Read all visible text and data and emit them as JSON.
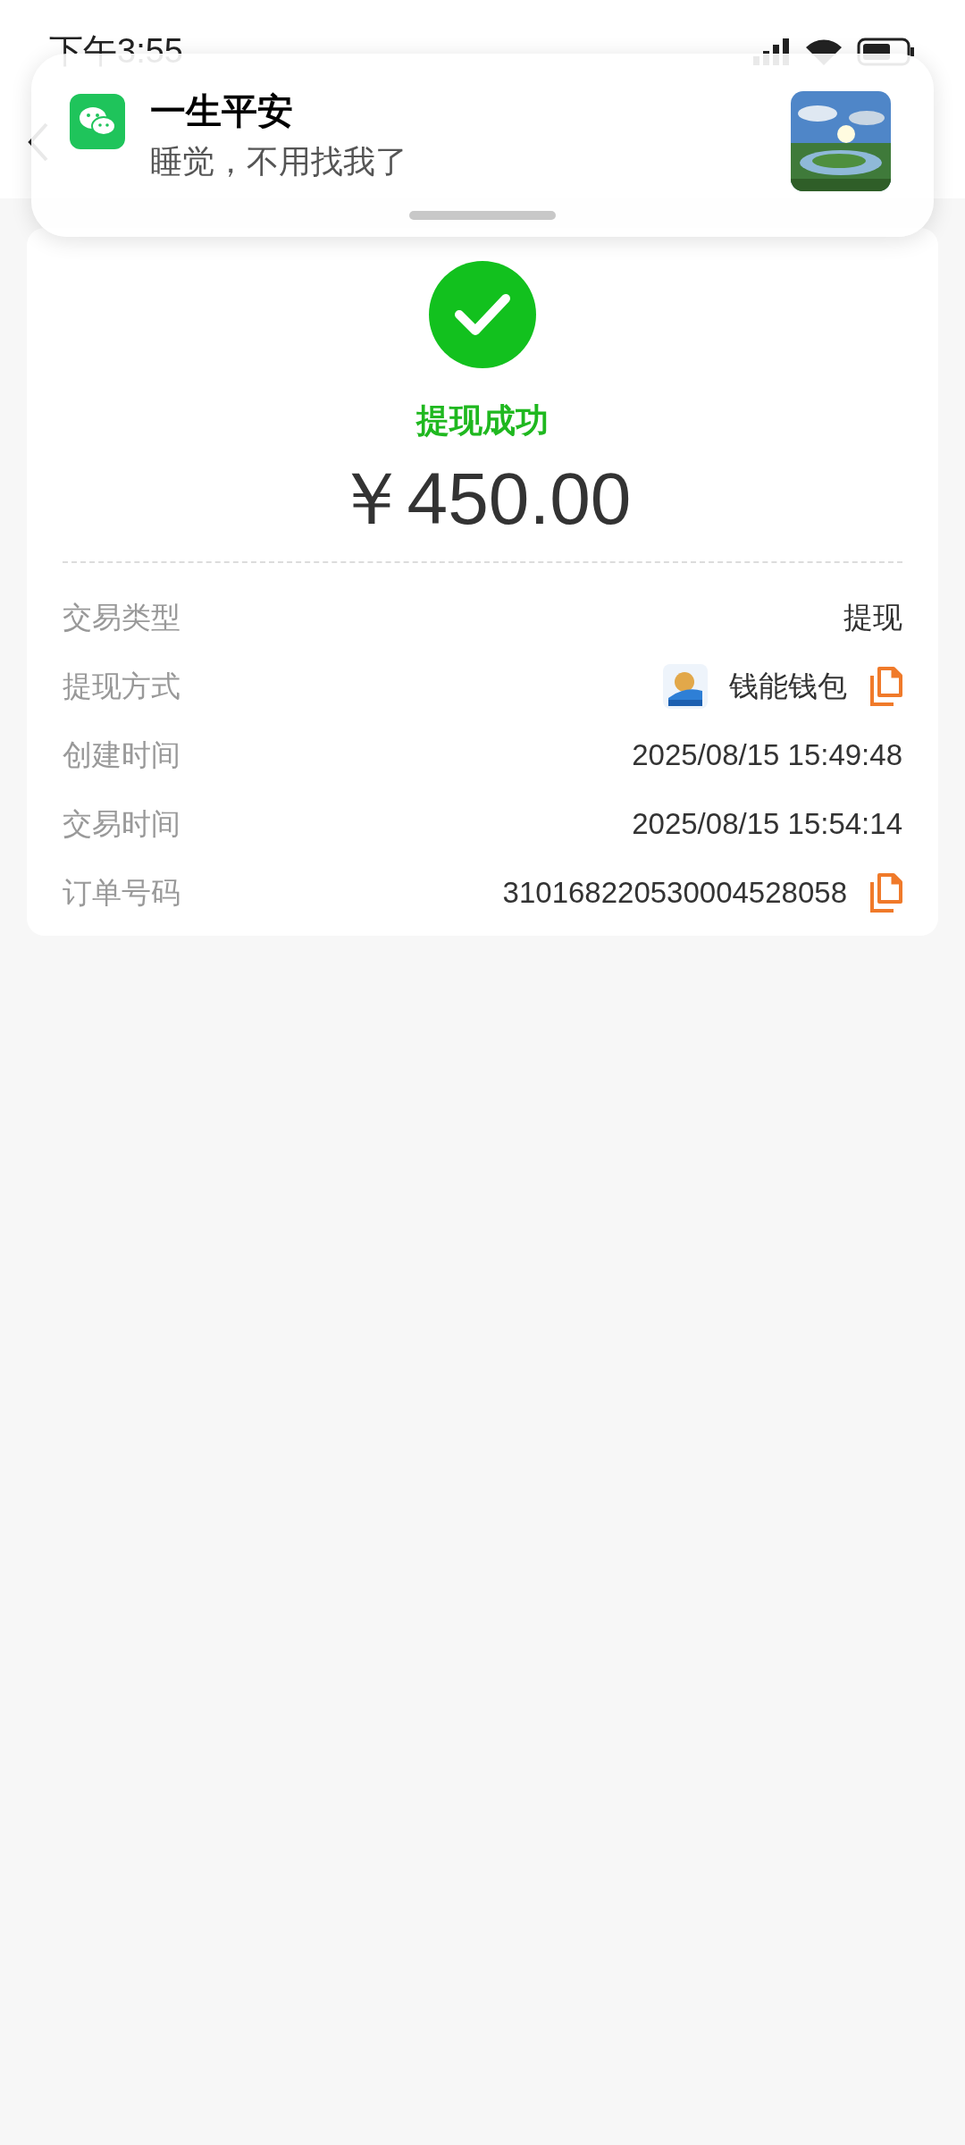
{
  "status_bar": {
    "time": "下午3:55"
  },
  "notification": {
    "title": "一生平安",
    "message": "睡觉，不用找我了"
  },
  "result": {
    "status": "提现成功",
    "amount": "￥450.00"
  },
  "details": [
    {
      "label": "交易类型",
      "value": "提现",
      "app_icon": false,
      "copy": false
    },
    {
      "label": "提现方式",
      "value": "钱能钱包",
      "app_icon": true,
      "copy": true
    },
    {
      "label": "创建时间",
      "value": "2025/08/15 15:49:48",
      "app_icon": false,
      "copy": false
    },
    {
      "label": "交易时间",
      "value": "2025/08/15 15:54:14",
      "app_icon": false,
      "copy": false
    },
    {
      "label": "订单号码",
      "value": "310168220530004528058",
      "app_icon": false,
      "copy": true
    }
  ]
}
